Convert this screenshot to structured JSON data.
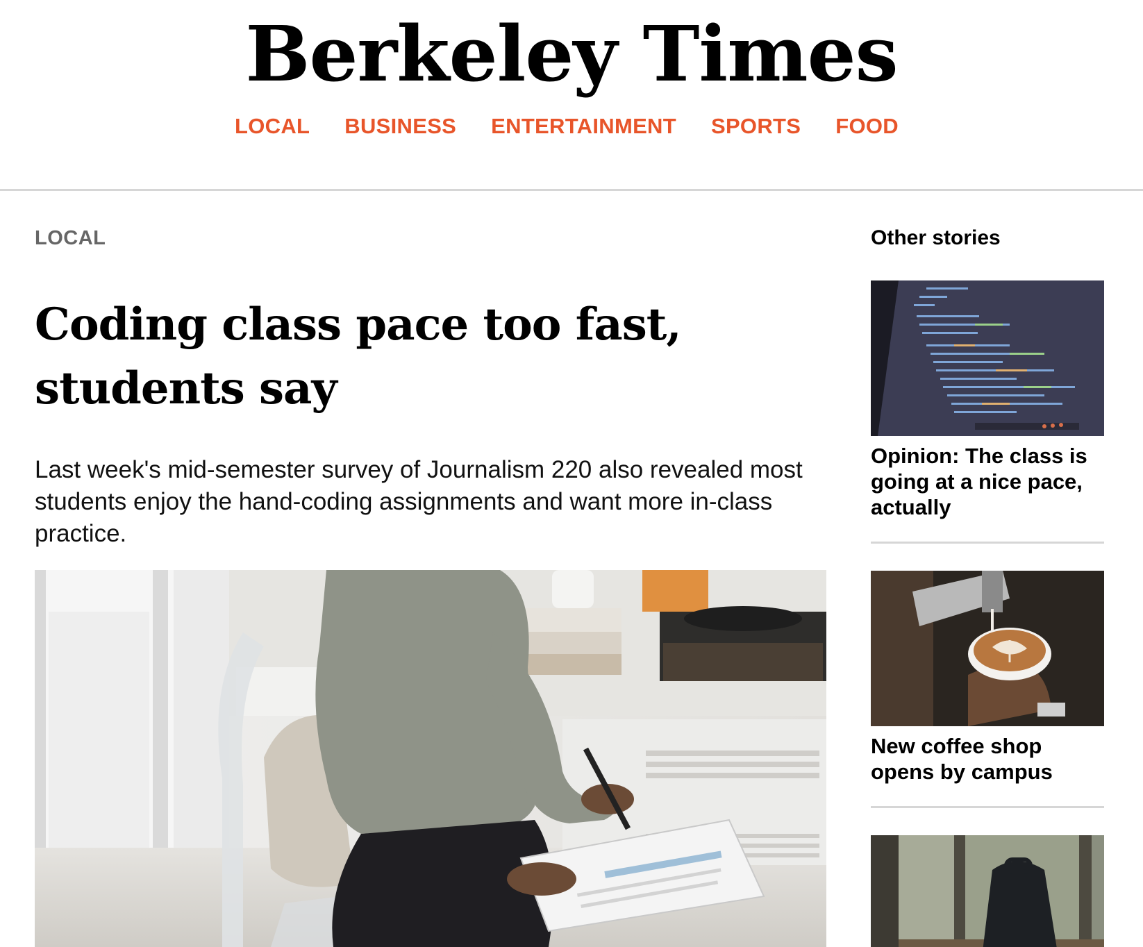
{
  "masthead": {
    "logo_text": "Berkeley Times"
  },
  "nav": {
    "items": [
      "LOCAL",
      "BUSINESS",
      "ENTERTAINMENT",
      "SPORTS",
      "FOOD"
    ]
  },
  "article": {
    "section": "LOCAL",
    "headline": "Coding class pace too fast, students say",
    "dek": "Last week's mid-semester survey of Journalism 220 also revealed most students enjoy the hand-coding assignments and want more in-class practice."
  },
  "sidebar": {
    "title": "Other stories",
    "stories": [
      {
        "title": "Opinion: The class is going at a nice pace, actually"
      },
      {
        "title": "New coffee shop opens by campus"
      },
      {
        "title": ""
      }
    ]
  },
  "colors": {
    "nav_accent": "#e8552a",
    "section_label": "#666666",
    "divider": "#d6d6d6"
  }
}
